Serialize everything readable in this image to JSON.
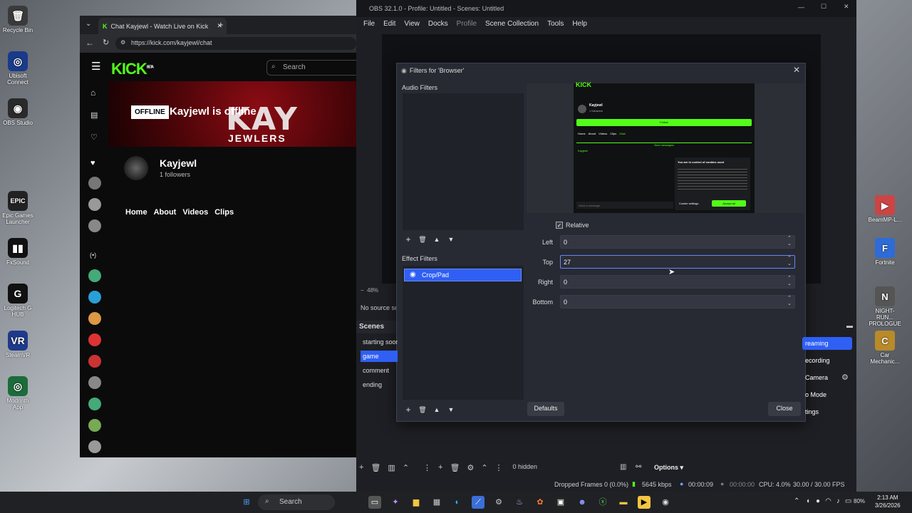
{
  "desktop": {
    "icons": [
      {
        "label": "Recycle Bin",
        "glyph": "🗑"
      },
      {
        "label": "Ubisoft Connect",
        "glyph": "◎"
      },
      {
        "label": "OBS Studio",
        "glyph": "◉"
      },
      {
        "label": "Epic Games Launcher",
        "glyph": "EPIC"
      },
      {
        "label": "FxSound",
        "glyph": "▮▮"
      },
      {
        "label": "Logitech G HUB",
        "glyph": "G"
      },
      {
        "label": "SteamVR",
        "glyph": "VR"
      },
      {
        "label": "Modrinth App",
        "glyph": "◎"
      }
    ],
    "right_icons": [
      {
        "label": "BeamMP-L...",
        "glyph": "▶"
      },
      {
        "label": "Fortnite",
        "glyph": "F"
      },
      {
        "label": "NIGHT-RUN... PROLOGUE",
        "glyph": "N"
      },
      {
        "label": "Car Mechanic...",
        "glyph": "C"
      }
    ]
  },
  "browser": {
    "tab_title": "Chat Kayjewl - Watch Live on Kick",
    "url": "https://kick.com/kayjewl/chat",
    "logo": "KICK",
    "logo_sup": "BETA",
    "search_placeholder": "Search",
    "offline_badge": "OFFLINE",
    "offline_text": "Kayjewl is offline",
    "banner_text": "KAY",
    "banner_sub": "JEWLERS",
    "channel_name": "Kayjewl",
    "followers": "1 followers",
    "nav": [
      "Home",
      "About",
      "Videos",
      "Clips"
    ]
  },
  "obs": {
    "title": "OBS 32.1.0 - Profile: Untitled - Scenes: Untitled",
    "menu": [
      "File",
      "Edit",
      "View",
      "Docks",
      "Profile",
      "Scene Collection",
      "Tools",
      "Help"
    ],
    "zoom": "48%",
    "no_source": "No source se",
    "scenes_header": "Scenes",
    "scenes": [
      "starting soon",
      "game",
      "comment",
      "ending"
    ],
    "controls": [
      "reaming",
      "ecording",
      "Camera",
      "o Mode",
      "tings"
    ],
    "hidden_label": "0 hidden",
    "options_label": "Options",
    "status": {
      "dropped": "Dropped Frames 0 (0.0%)",
      "kbps": "5645 kbps",
      "rec_time": "00:00:09",
      "stream_time": "00:00:00",
      "cpu": "CPU: 4.0%",
      "fps": "30.00 / 30.00 FPS"
    }
  },
  "filters_dialog": {
    "title": "Filters for 'Browser'",
    "audio_filters_label": "Audio Filters",
    "effect_filters_label": "Effect Filters",
    "effect_filters": [
      "Crop/Pad"
    ],
    "relative_label": "Relative",
    "relative_checked": true,
    "fields": [
      {
        "label": "Left",
        "value": "0"
      },
      {
        "label": "Top",
        "value": "27"
      },
      {
        "label": "Right",
        "value": "0"
      },
      {
        "label": "Bottom",
        "value": "0"
      }
    ],
    "preview": {
      "logo": "KICK",
      "channel": "Kayjewl",
      "followers": "1 followers",
      "follow_btn": "Follow",
      "tabs": [
        "Home",
        "About",
        "Videos",
        "Clips",
        "Chat"
      ],
      "new_messages": "New messages",
      "chat_user": "Kayjewl",
      "cookie_title": "You are in control of cookies used",
      "cookie_settings": "Cookie settings",
      "accept_all": "Accept all",
      "send_placeholder": "Send a message"
    },
    "defaults_btn": "Defaults",
    "close_btn": "Close"
  },
  "taskbar": {
    "search": "Search",
    "time": "2:13 AM",
    "date": "3/26/2026",
    "battery": "80%"
  }
}
